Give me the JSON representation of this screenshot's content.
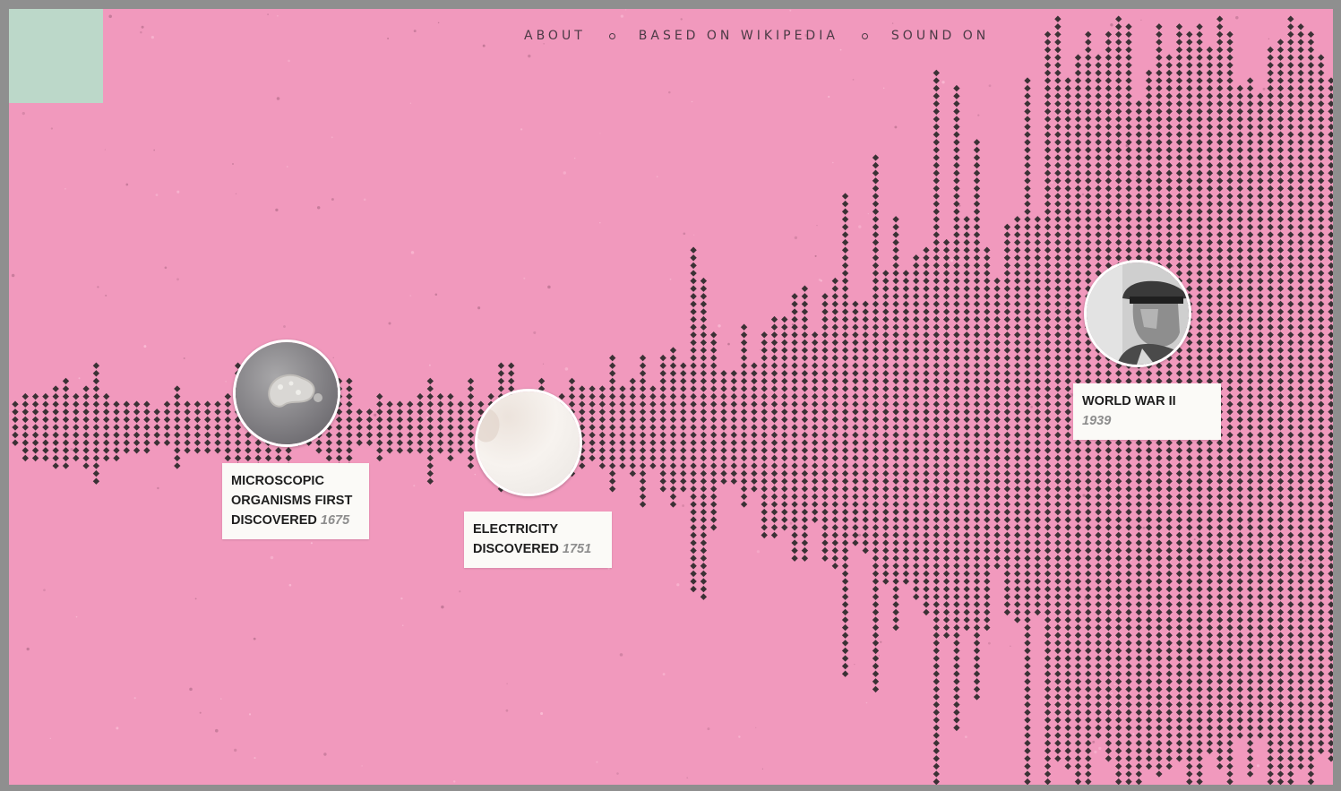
{
  "nav": {
    "items": [
      {
        "label": "ABOUT"
      },
      {
        "label": "BASED ON WIKIPEDIA"
      },
      {
        "label": "SOUND ON"
      }
    ]
  },
  "colors": {
    "background": "#f199bd",
    "frame": "#8f8f8f",
    "logo": "#bcd8c9",
    "dot": "#3b3135",
    "card": "#fbfaf7",
    "year": "#8d8d8d"
  },
  "events": [
    {
      "title_line1": "MICROSCOPIC",
      "title_line2": "ORGANISMS FIRST",
      "title_line3": "DISCOVERED",
      "year": "1675",
      "image": "microorganism-photo"
    },
    {
      "title_line1": "ELECTRICITY",
      "title_line2": "DISCOVERED",
      "year": "1751",
      "image": "electricity-photo"
    },
    {
      "title_line1": "WORLD WAR II",
      "year": "1939",
      "image": "soldier-portrait-photo"
    }
  ]
}
